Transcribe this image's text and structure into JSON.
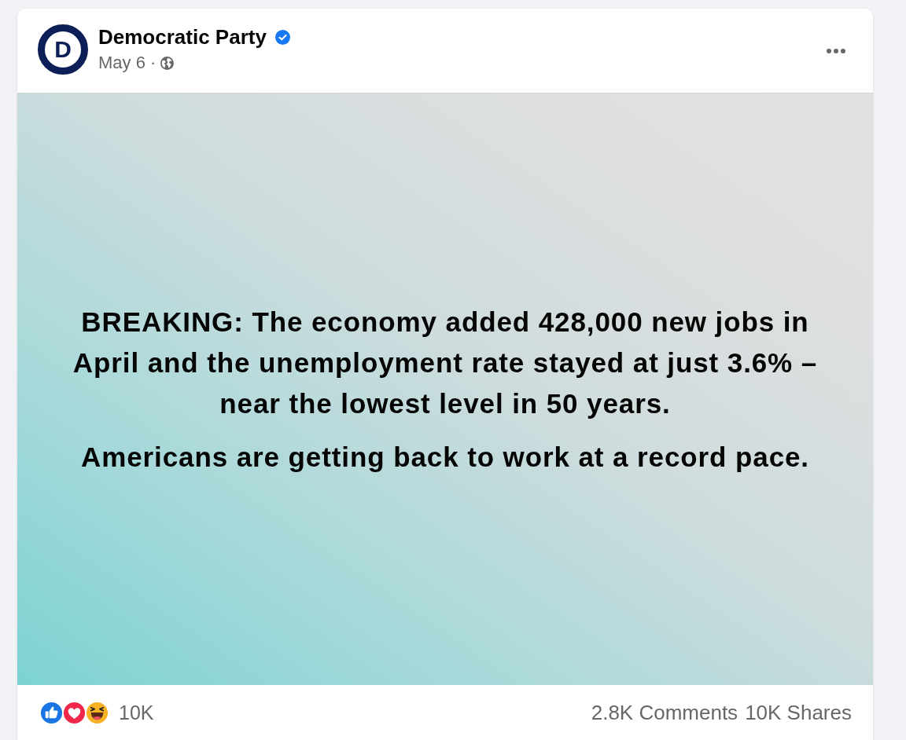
{
  "post": {
    "author": {
      "logo_letter": "D",
      "name": "Democratic Party",
      "verified": true
    },
    "date": "May 6 ·",
    "body": [
      "BREAKING: The economy added 428,000 new jobs in April and the unemployment rate stayed at just 3.6% – near the lowest level in 50 years.",
      "Americans are getting back to work at a record pace."
    ]
  },
  "engagement": {
    "reactions": [
      {
        "kind": "like"
      },
      {
        "kind": "love"
      },
      {
        "kind": "haha"
      }
    ],
    "reaction_count": "10K",
    "comments": "2.8K Comments",
    "shares": "10K Shares"
  }
}
